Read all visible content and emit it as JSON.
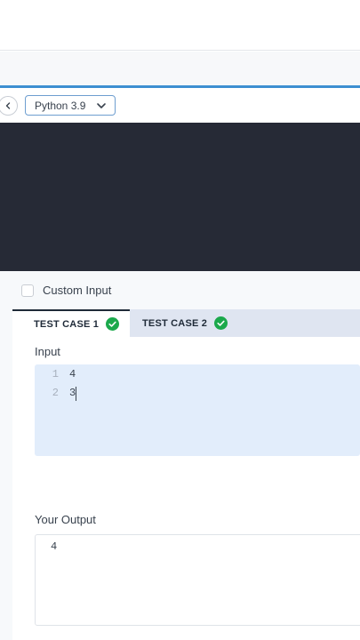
{
  "toolbar": {
    "back_icon": "chevron-left-icon",
    "language": "Python 3.9",
    "language_chevron_icon": "chevron-down-icon"
  },
  "custom_input": {
    "label": "Custom Input",
    "checked": false
  },
  "tabs": [
    {
      "label": "TEST CASE 1",
      "status_icon": "check-circle-icon",
      "status_color": "#1ba94c",
      "active": true
    },
    {
      "label": "TEST CASE 2",
      "status_icon": "check-circle-icon",
      "status_color": "#1ba94c",
      "active": false
    }
  ],
  "input_section": {
    "title": "Input",
    "lines": [
      {
        "number": "1",
        "value": "4"
      },
      {
        "number": "2",
        "value": "3"
      }
    ]
  },
  "output_section": {
    "title": "Your Output",
    "value": "4"
  },
  "colors": {
    "accent_blue": "#3d8fd1",
    "editor_bg": "#262a36",
    "pass_green": "#1ba94c",
    "input_bg": "#e2edfb"
  }
}
